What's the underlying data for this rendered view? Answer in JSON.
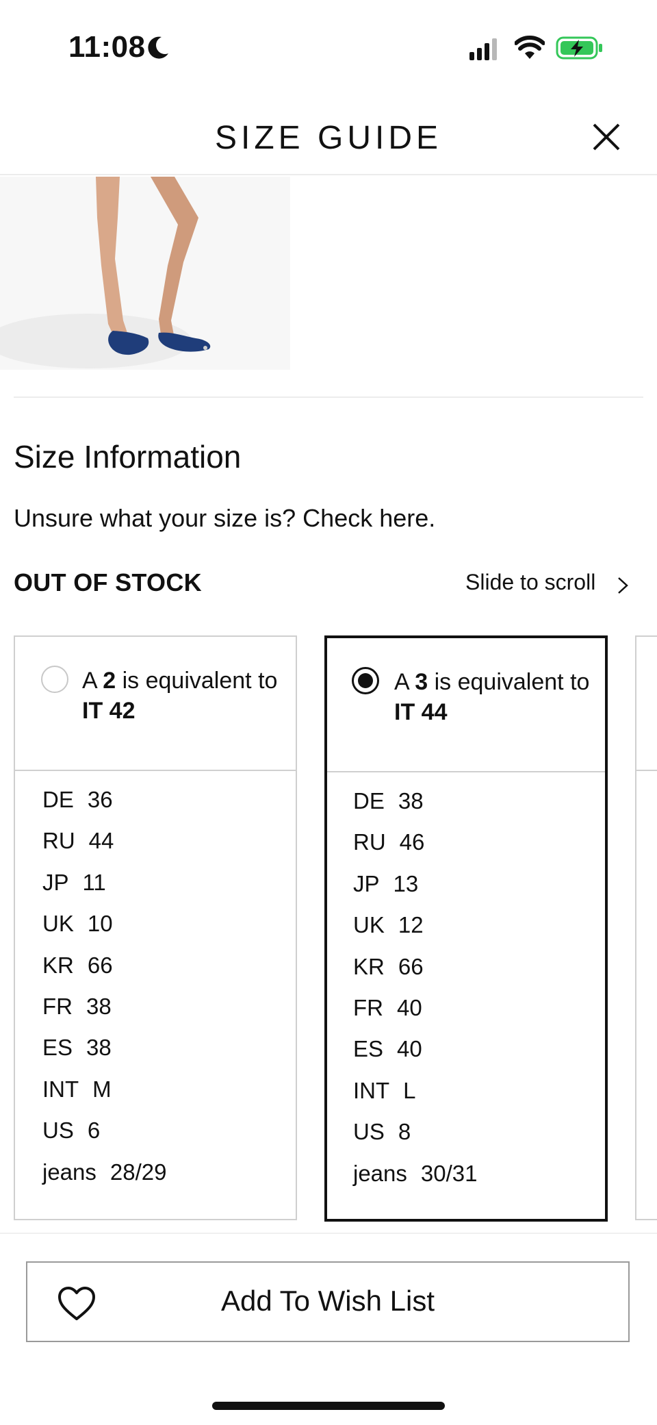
{
  "status_bar": {
    "time": "11:08",
    "icons": [
      "moon-icon",
      "signal-icon",
      "wifi-icon",
      "battery-charging-icon"
    ],
    "battery_color": "#34c759"
  },
  "header": {
    "title": "SIZE GUIDE",
    "close_icon": "close-icon"
  },
  "section": {
    "title": "Size Information",
    "help_link": "Unsure what your size is? Check here.",
    "stock_status": "OUT OF STOCK",
    "scroll_hint": "Slide to scroll"
  },
  "cards": [
    {
      "selected": false,
      "equiv_prefix": "A ",
      "size": "2",
      "equiv_mid": " is equivalent to ",
      "equiv_target": "IT 42",
      "rows": [
        {
          "code": "DE",
          "value": "36"
        },
        {
          "code": "RU",
          "value": "44"
        },
        {
          "code": "JP",
          "value": "11"
        },
        {
          "code": "UK",
          "value": "10"
        },
        {
          "code": "KR",
          "value": "66"
        },
        {
          "code": "FR",
          "value": "38"
        },
        {
          "code": "ES",
          "value": "38"
        },
        {
          "code": "INT",
          "value": "M"
        },
        {
          "code": "US",
          "value": "6"
        },
        {
          "code": "jeans",
          "value": "28/29"
        }
      ]
    },
    {
      "selected": true,
      "equiv_prefix": "A ",
      "size": "3",
      "equiv_mid": " is equivalent to ",
      "equiv_target": "IT 44",
      "rows": [
        {
          "code": "DE",
          "value": "38"
        },
        {
          "code": "RU",
          "value": "46"
        },
        {
          "code": "JP",
          "value": "13"
        },
        {
          "code": "UK",
          "value": "12"
        },
        {
          "code": "KR",
          "value": "66"
        },
        {
          "code": "FR",
          "value": "40"
        },
        {
          "code": "ES",
          "value": "40"
        },
        {
          "code": "INT",
          "value": "L"
        },
        {
          "code": "US",
          "value": "8"
        },
        {
          "code": "jeans",
          "value": "30/31"
        }
      ]
    }
  ],
  "footer": {
    "wish_label": "Add To Wish List",
    "wish_icon": "heart-icon"
  }
}
